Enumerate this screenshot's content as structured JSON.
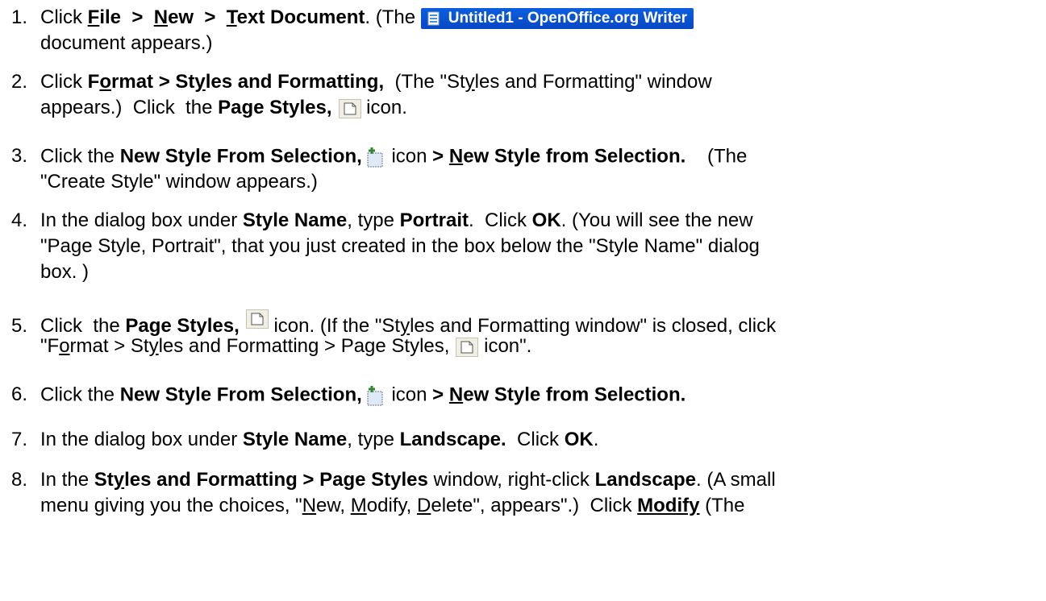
{
  "steps": {
    "s1": {
      "num": "1.",
      "a": "Click ",
      "file": "ile",
      "file_u": "F",
      "sep1": "  >  ",
      "new": "ew",
      "new_u": "N",
      "sep2": "  >  ",
      "text": "ext Document",
      "text_u": "T",
      "b": ". (The ",
      "window_title": "Untitled1 - OpenOffice.org Writer",
      "c": "document appears.)"
    },
    "s2": {
      "num": "2.",
      "a": "Click ",
      "format_pre": "F",
      "format_u": "o",
      "format_post": "rmat > St",
      "styles_u": "y",
      "styles_post": "les and Formatting,",
      "b": "  (The \"St",
      "b_u": "y",
      "c": "les and Formatting\" window",
      "d": "appears.)  Click  the ",
      "page_styles": "Page Styles,",
      "e": " icon."
    },
    "s3": {
      "num": "3.",
      "a": "Click the ",
      "nsfs": "New Style From Selection,",
      "comma": ",",
      "b": " icon ",
      "gt": "> ",
      "n_u": "N",
      "c": "ew Style from Selection.",
      "d": "    (The",
      "e": "\"Create Style\" window appears.)"
    },
    "s4": {
      "num": "4.",
      "a": "In the dialog box under ",
      "style_name": "Style Name",
      "b": ", type ",
      "portrait": "Portrait",
      "c": ".  Click ",
      "ok": "OK",
      "d": ". (You will see the new",
      "e": "\"Page Style, Portrait\", that you just created in the box below the \"Style Name\" dialog",
      "f": "box. )"
    },
    "s5": {
      "num": "5.",
      "a": "Click  the ",
      "page_styles": "Page Styles,",
      "b": " icon. (If the \"St",
      "b_u": "y",
      "c": "les and Formatting window\" is closed, click",
      "d": "\"F",
      "d_u": "o",
      "e": "rmat > St",
      "e_u": "y",
      "f": "les and Formatting > Page Styles,",
      "g": " icon\"."
    },
    "s6": {
      "num": "6.",
      "a": "Click the ",
      "nsfs": "New Style From Selection,",
      "comma": ",",
      "b": " icon ",
      "gt": "> ",
      "n_u": "N",
      "c": "ew Style from Selection."
    },
    "s7": {
      "num": "7.",
      "a": "In the dialog box under ",
      "style_name": "Style Name",
      "b": ", type ",
      "landscape": "Landscape.",
      "c": "  Click ",
      "ok": "OK",
      "d": "."
    },
    "s8": {
      "num": "8.",
      "a": "In the ",
      "sf_pre": "St",
      "sf_u": "y",
      "sf_post": "les and Formatting > Page Styles",
      "b": " window, right-click ",
      "landscape": "Landscape",
      "c": ". (A small",
      "d": "menu giving you the choices, \"",
      "n_u": "N",
      "e": "ew, ",
      "m_u": "M",
      "f": "odify, ",
      "d_u": "D",
      "g": "elete\", appears\".)  Click ",
      "modify": "Modify",
      "h": " (The"
    }
  }
}
